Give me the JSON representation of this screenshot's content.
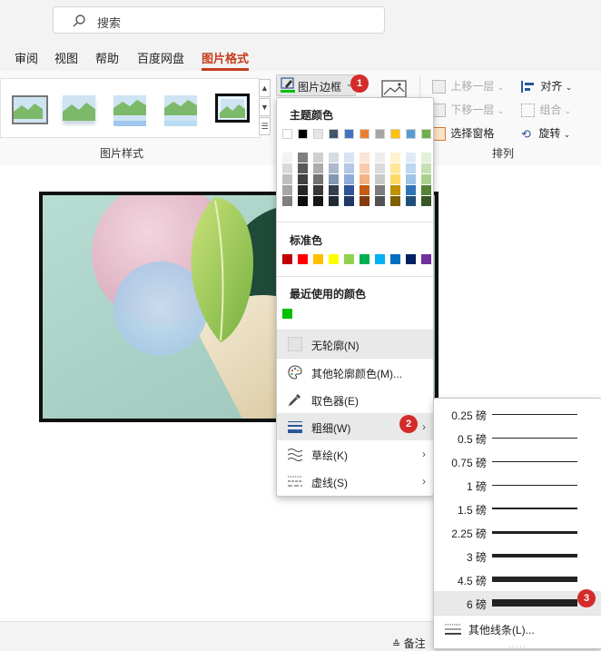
{
  "search": {
    "placeholder": "搜索"
  },
  "tabs": [
    {
      "label": "审阅"
    },
    {
      "label": "视图"
    },
    {
      "label": "帮助"
    },
    {
      "label": "百度网盘"
    },
    {
      "label": "图片格式",
      "active": true
    }
  ],
  "ribbon": {
    "border_button_label": "图片边框",
    "group_picture_styles": "图片样式",
    "group_arrange": "排列",
    "bring_forward": "上移一层",
    "send_backward": "下移一层",
    "selection_pane": "选择窗格",
    "align": "对齐",
    "group": "组合",
    "rotate": "旋转"
  },
  "color_menu": {
    "theme_colors_header": "主题颜色",
    "standard_colors_header": "标准色",
    "recent_colors_header": "最近使用的颜色",
    "theme_top_row": [
      "#ffffff",
      "#000000",
      "#e7e6e6",
      "#44546a",
      "#4472c4",
      "#ed7d31",
      "#a5a5a5",
      "#ffc000",
      "#5b9bd5",
      "#70ad47"
    ],
    "theme_shades": [
      [
        "#f2f2f2",
        "#d9d9d9",
        "#bfbfbf",
        "#a6a6a6",
        "#7f7f7f"
      ],
      [
        "#7f7f7f",
        "#595959",
        "#404040",
        "#262626",
        "#0d0d0d"
      ],
      [
        "#d0cece",
        "#aeabab",
        "#757171",
        "#3a3838",
        "#171616"
      ],
      [
        "#d6dce4",
        "#adb9ca",
        "#8497b0",
        "#333f4f",
        "#222a35"
      ],
      [
        "#dae3f3",
        "#b4c7e7",
        "#8faadc",
        "#2f5597",
        "#1f3864"
      ],
      [
        "#fbe5d6",
        "#f8cbad",
        "#f4b183",
        "#c55a11",
        "#843c0c"
      ],
      [
        "#ededed",
        "#dbdbdb",
        "#c9c9c9",
        "#7b7b7b",
        "#525252"
      ],
      [
        "#fff2cc",
        "#ffe699",
        "#ffd966",
        "#bf9000",
        "#7f6000"
      ],
      [
        "#deebf7",
        "#bdd7ee",
        "#9dc3e6",
        "#2e75b6",
        "#1f4e79"
      ],
      [
        "#e2f0d9",
        "#c5e0b4",
        "#a9d18e",
        "#548235",
        "#375623"
      ]
    ],
    "standard_colors": [
      "#c00000",
      "#ff0000",
      "#ffc000",
      "#ffff00",
      "#92d050",
      "#00b050",
      "#00b0f0",
      "#0070c0",
      "#002060",
      "#7030a0"
    ],
    "recent_colors": [
      "#00c000"
    ],
    "items": [
      {
        "label": "无轮廓(N)",
        "icon": "no-outline-icon",
        "highlight": true
      },
      {
        "label": "其他轮廓颜色(M)...",
        "icon": "palette-icon"
      },
      {
        "label": "取色器(E)",
        "icon": "eyedropper-icon"
      },
      {
        "label": "粗细(W)",
        "icon": "weight-icon",
        "submenu": true,
        "highlight": true
      },
      {
        "label": "草绘(K)",
        "icon": "sketch-icon",
        "submenu": true
      },
      {
        "label": "虚线(S)",
        "icon": "dash-icon",
        "submenu": true
      }
    ]
  },
  "weight_menu": {
    "items": [
      {
        "label": "0.25 磅",
        "weight": 0.25
      },
      {
        "label": "0.5 磅",
        "weight": 0.5
      },
      {
        "label": "0.75 磅",
        "weight": 0.75
      },
      {
        "label": "1 磅",
        "weight": 1
      },
      {
        "label": "1.5 磅",
        "weight": 1.5
      },
      {
        "label": "2.25 磅",
        "weight": 2.25
      },
      {
        "label": "3 磅",
        "weight": 3
      },
      {
        "label": "4.5 磅",
        "weight": 4.5
      },
      {
        "label": "6 磅",
        "weight": 6,
        "highlight": true
      }
    ],
    "more_lines": "其他线条(L)..."
  },
  "badges": [
    "1",
    "2",
    "3"
  ],
  "status_bar": {
    "notes": "备注"
  }
}
